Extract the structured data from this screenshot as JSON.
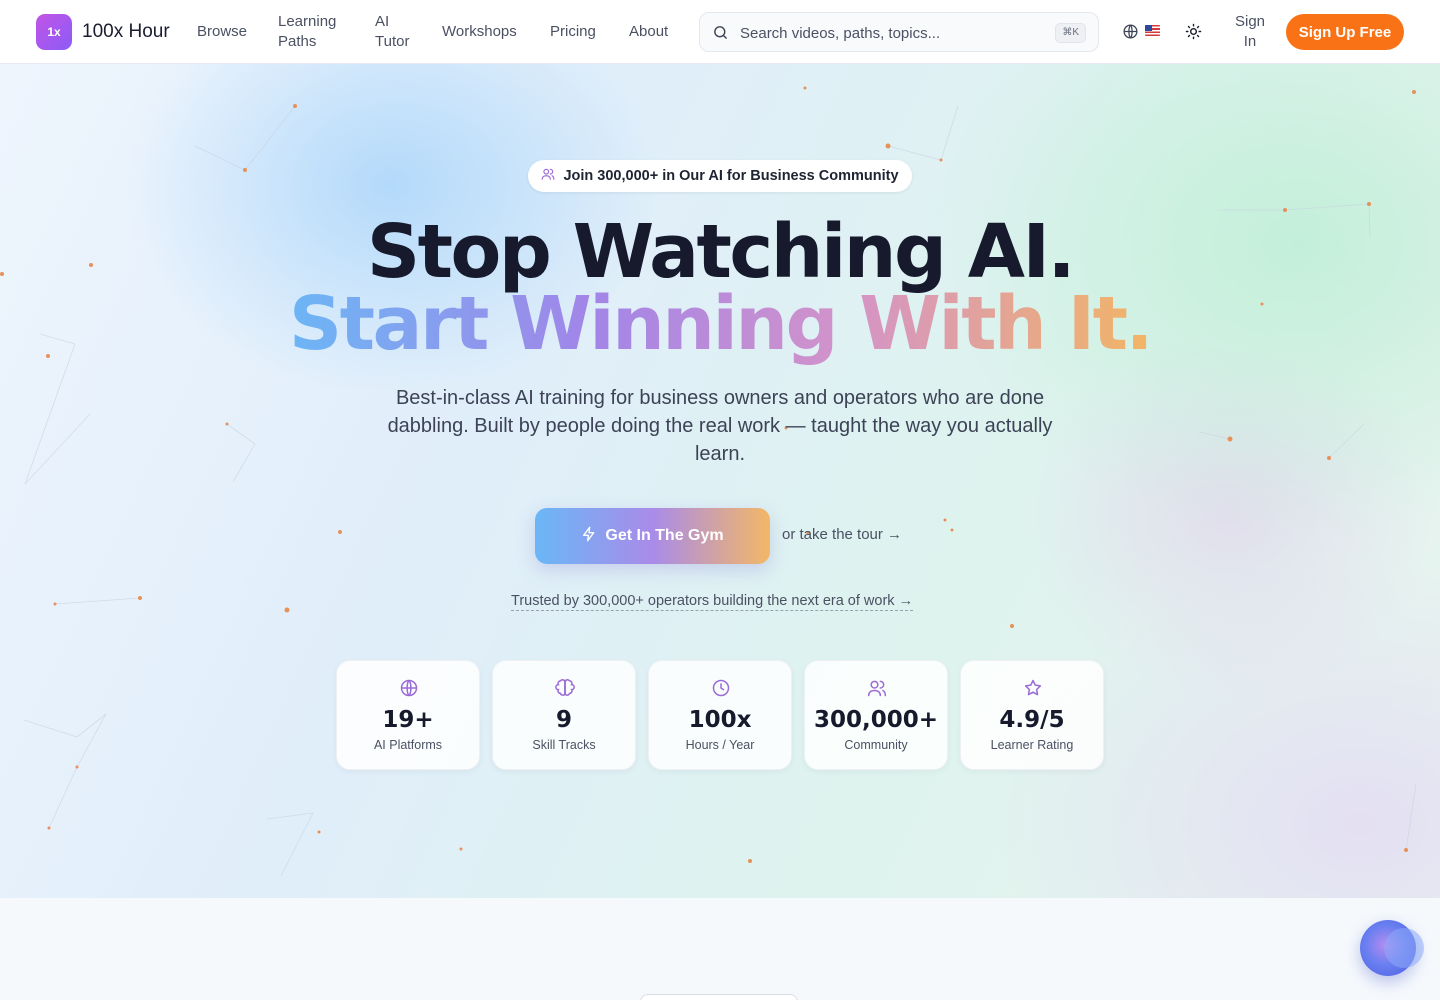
{
  "brand": {
    "logo_mark": "1x",
    "name": "100x Hour"
  },
  "nav": {
    "links": [
      "Browse",
      "Learning Paths",
      "AI Tutor",
      "Workshops",
      "Pricing",
      "About"
    ],
    "search_placeholder": "Search videos, paths, topics...",
    "search_shortcut": "⌘K",
    "sign_in": "Sign In",
    "sign_up": "Sign Up Free"
  },
  "hero": {
    "badge": "Join 300,000+ in Our AI for Business Community",
    "headline_line1": "Stop Watching AI.",
    "headline_line2": "Start Winning With It.",
    "subheadline": "Best-in-class AI training for business owners and operators who are done dabbling. Built by people doing the real work — taught the way you actually learn.",
    "primary_cta": "Get In The Gym",
    "secondary_cta": "or take the tour →",
    "trusted": "Trusted by 300,000+ operators building the next era of work →"
  },
  "stats": [
    {
      "icon": "globe-icon",
      "value": "19+",
      "label": "AI Platforms"
    },
    {
      "icon": "brain-icon",
      "value": "9",
      "label": "Skill Tracks"
    },
    {
      "icon": "clock-icon",
      "value": "100x",
      "label": "Hours / Year"
    },
    {
      "icon": "users-icon",
      "value": "300,000+",
      "label": "Community"
    },
    {
      "icon": "star-icon",
      "value": "4.9/5",
      "label": "Learner Rating"
    }
  ],
  "colors": {
    "accent": "#f97316",
    "brand": "#a855f7",
    "heading": "#161a2c",
    "icon": "#9b6bd6"
  }
}
